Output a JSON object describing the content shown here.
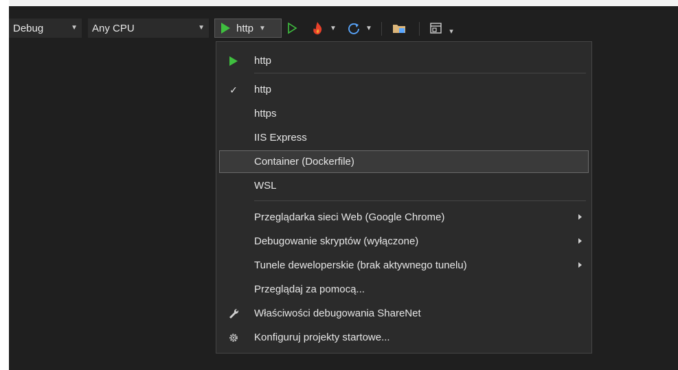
{
  "toolbar": {
    "config_value": "Debug",
    "platform_value": "Any CPU",
    "profile_value": "http"
  },
  "menu": {
    "header_item": "http",
    "profiles": [
      {
        "label": "http",
        "checked": true
      },
      {
        "label": "https"
      },
      {
        "label": "IIS Express"
      },
      {
        "label": "Container (Dockerfile)",
        "highlighted": true
      },
      {
        "label": "WSL"
      }
    ],
    "options": [
      {
        "label": "Przeglądarka sieci Web (Google Chrome)",
        "submenu": true
      },
      {
        "label": "Debugowanie skryptów (wyłączone)",
        "submenu": true
      },
      {
        "label": "Tunele deweloperskie (brak aktywnego tunelu)",
        "submenu": true
      },
      {
        "label": "Przeglądaj za pomocą..."
      },
      {
        "label": "Właściwości debugowania ShareNet",
        "icon": "wrench-icon"
      },
      {
        "label": "Konfiguruj projekty startowe...",
        "icon": "gear-icon"
      }
    ]
  },
  "colors": {
    "background": "#1f1f1f",
    "menu_bg": "#2b2b2b",
    "accent_green": "#3fbf3f",
    "hot_reload": "#e8402a"
  }
}
